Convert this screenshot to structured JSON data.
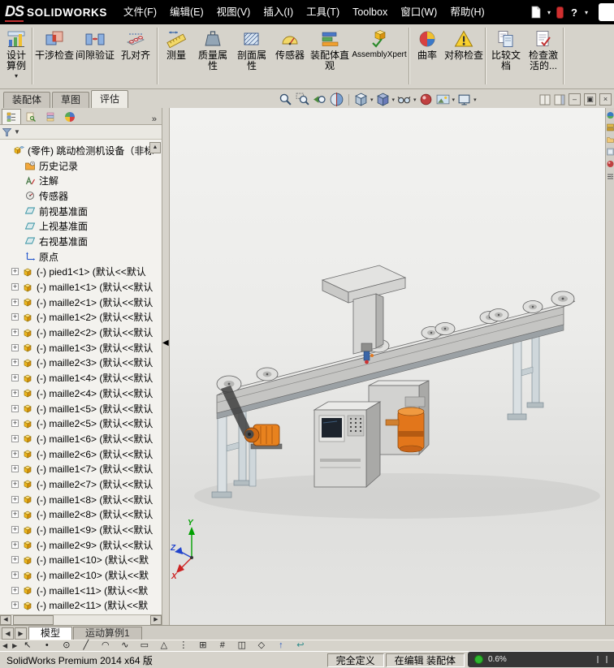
{
  "title_bar": {
    "logo_mark": "DS",
    "logo_text": "SOLIDWORKS",
    "menus": [
      "文件(F)",
      "编辑(E)",
      "视图(V)",
      "插入(I)",
      "工具(T)",
      "Toolbox",
      "窗口(W)",
      "帮助(H)"
    ],
    "help_label": "?",
    "icons": [
      "new-document-icon",
      "solidworks-id-badge",
      "help-icon"
    ]
  },
  "ribbon": {
    "buttons": [
      {
        "label": "设计算例",
        "icon": "design-study-icon"
      },
      {
        "label": "干涉检查",
        "icon": "interference-detection-icon"
      },
      {
        "label": "间隙验证",
        "icon": "clearance-verification-icon"
      },
      {
        "label": "孔对齐",
        "icon": "hole-alignment-icon"
      },
      {
        "label": "测量",
        "icon": "measure-icon"
      },
      {
        "label": "质量属性",
        "icon": "mass-properties-icon"
      },
      {
        "label": "剖面属性",
        "icon": "section-properties-icon"
      },
      {
        "label": "传感器",
        "icon": "sensor-icon"
      },
      {
        "label": "装配体直观",
        "icon": "assembly-visualization-icon"
      },
      {
        "label": "AssemblyXpert",
        "icon": "assemblyxpert-icon"
      },
      {
        "label": "曲率",
        "icon": "curvature-icon"
      },
      {
        "label": "对称检查",
        "icon": "symmetry-check-icon"
      },
      {
        "label": "比较文档",
        "icon": "compare-documents-icon"
      },
      {
        "label": "检查激活的...",
        "icon": "check-active-document-icon"
      }
    ]
  },
  "document_tabs": {
    "items": [
      "装配体",
      "草图",
      "评估"
    ],
    "active": "评估"
  },
  "hud": {
    "icons": [
      "zoom-fit",
      "zoom-area",
      "previous-view",
      "section-view",
      "view-orientation",
      "display-style",
      "hide-show-items",
      "edit-appearance",
      "apply-scene",
      "view-settings"
    ]
  },
  "window_controls": {
    "minimize": "–",
    "restore": "▣",
    "close": "×"
  },
  "feature_panel": {
    "tabs": [
      "featuremanager",
      "propertymanager",
      "configurationmanager",
      "displaymanager"
    ],
    "expand_glyph": "»",
    "root_label": "(零件) 跳动检测机设备（非标",
    "items": [
      {
        "label": "历史记录",
        "icon": "history-folder-icon"
      },
      {
        "label": "注解",
        "icon": "annotations-icon"
      },
      {
        "label": "传感器",
        "icon": "sensors-icon"
      },
      {
        "label": "前视基准面",
        "icon": "plane-icon"
      },
      {
        "label": "上视基准面",
        "icon": "plane-icon"
      },
      {
        "label": "右视基准面",
        "icon": "plane-icon"
      },
      {
        "label": "原点",
        "icon": "origin-icon"
      }
    ],
    "components": [
      "(-) pied1<1> (默认<<默认",
      "(-) maille1<1> (默认<<默认",
      "(-) maille2<1> (默认<<默认",
      "(-) maille1<2> (默认<<默认",
      "(-) maille2<2> (默认<<默认",
      "(-) maille1<3> (默认<<默认",
      "(-) maille2<3> (默认<<默认",
      "(-) maille1<4> (默认<<默认",
      "(-) maille2<4> (默认<<默认",
      "(-) maille1<5> (默认<<默认",
      "(-) maille2<5> (默认<<默认",
      "(-) maille1<6> (默认<<默认",
      "(-) maille2<6> (默认<<默认",
      "(-) maille1<7> (默认<<默认",
      "(-) maille2<7> (默认<<默认",
      "(-) maille1<8> (默认<<默认",
      "(-) maille2<8> (默认<<默认",
      "(-) maille1<9> (默认<<默认",
      "(-) maille2<9> (默认<<默认",
      "(-) maille1<10> (默认<<默",
      "(-) maille2<10> (默认<<默",
      "(-) maille1<11> (默认<<默",
      "(-) maille2<11> (默认<<默"
    ]
  },
  "viewport": {
    "triad": {
      "x": "X",
      "y": "Y",
      "z": "Z"
    }
  },
  "task_pane": {
    "icons": [
      "solidworks-resources",
      "design-library",
      "file-explorer",
      "view-palette",
      "appearances-scenes",
      "custom-properties"
    ]
  },
  "model_tabs": {
    "items": [
      "模型",
      "运动算例1"
    ],
    "active": "模型"
  },
  "sketch_toolbar": {
    "tools": [
      {
        "name": "select",
        "glyph": "↖"
      },
      {
        "name": "sketch-point",
        "glyph": "•"
      },
      {
        "name": "circle",
        "glyph": "⊙"
      },
      {
        "name": "line",
        "glyph": "╱"
      },
      {
        "name": "arc",
        "glyph": "◠"
      },
      {
        "name": "spline",
        "glyph": "∿"
      },
      {
        "name": "rectangle",
        "glyph": "▭"
      },
      {
        "name": "polygon",
        "glyph": "△"
      },
      {
        "name": "point-pattern",
        "glyph": "⋮"
      },
      {
        "name": "grid",
        "glyph": "⊞"
      },
      {
        "name": "dimension",
        "glyph": "#"
      },
      {
        "name": "mirror-entities",
        "glyph": "◫"
      },
      {
        "name": "rhombus",
        "glyph": "◇"
      },
      {
        "name": "3d-sketch",
        "glyph": "↑"
      },
      {
        "name": "exit-sketch",
        "glyph": "↩"
      }
    ]
  },
  "status_bar": {
    "product": "SolidWorks Premium 2014 x64 版",
    "definition_state": "完全定义",
    "editing_state": "在编辑 装配体",
    "overlay_value": "0.6%"
  },
  "glyphs": {
    "caret": "▾",
    "filter_caret": "▼",
    "up": "▲",
    "left": "◀",
    "right": "▶",
    "plus": "+"
  }
}
